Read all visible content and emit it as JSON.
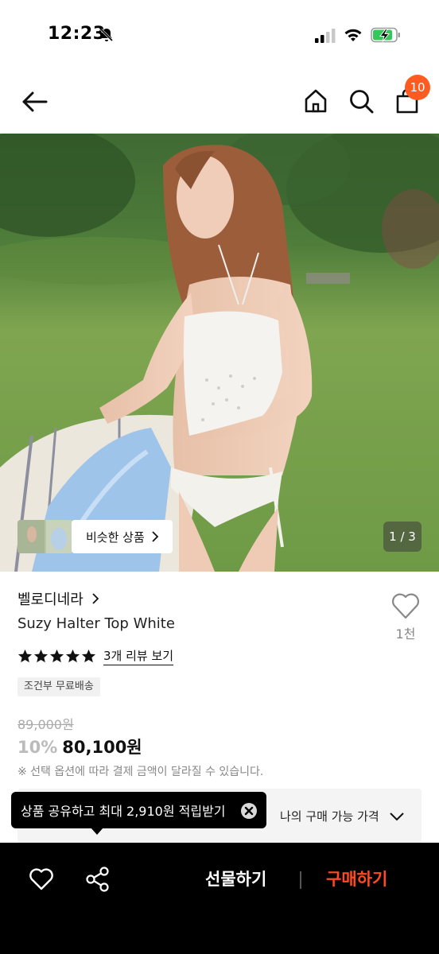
{
  "status_bar": {
    "time": "12:23"
  },
  "header": {
    "cart_count": "10"
  },
  "gallery": {
    "similar_label": "비슷한 상품",
    "page_indicator": "1 / 3"
  },
  "product": {
    "brand": "벨로디네라",
    "name": "Suzy Halter Top White",
    "like_count": "1천",
    "rating": 5,
    "review_link": "3개 리뷰 보기",
    "shipping_tag": "조건부 무료배송",
    "original_price": "89,000원",
    "discount": "10%",
    "sale_price": "80,100원",
    "price_note": "※ 선택 옵션에 따라 결제 금액이 달라질 수 있습니다.",
    "my_price_label": "나의 구매 가능 가격"
  },
  "tooltip": {
    "text": "상품 공유하고 최대 2,910원 적립받기"
  },
  "bottom_bar": {
    "gift_label": "선물하기",
    "buy_label": "구매하기"
  },
  "colors": {
    "accent": "#ff4a24",
    "badge": "#ff5a1f",
    "bottom_bar": "#000000"
  },
  "icons": [
    "bell-off-icon",
    "signal-icon",
    "wifi-icon",
    "battery-charging-icon",
    "back-arrow-icon",
    "home-icon",
    "search-icon",
    "shopping-bag-icon",
    "chevron-right-icon",
    "heart-icon",
    "star-icon",
    "chevron-down-icon",
    "close-circle-icon",
    "share-icon"
  ]
}
